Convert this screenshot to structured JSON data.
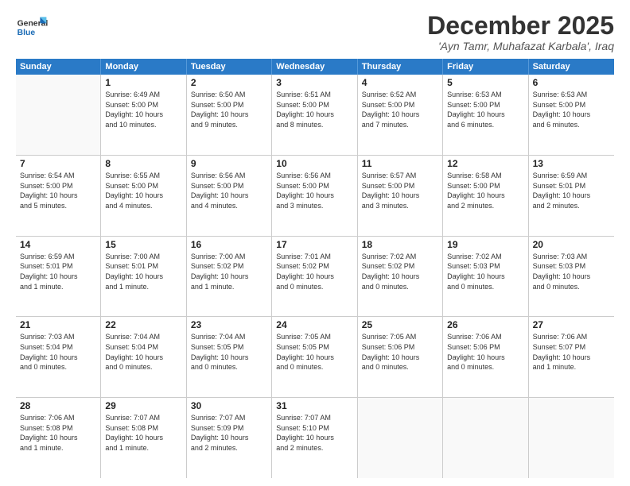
{
  "header": {
    "logo_general": "General",
    "logo_blue": "Blue",
    "title": "December 2025",
    "subtitle": "'Ayn Tamr, Muhafazat Karbala', Iraq"
  },
  "calendar": {
    "days_of_week": [
      "Sunday",
      "Monday",
      "Tuesday",
      "Wednesday",
      "Thursday",
      "Friday",
      "Saturday"
    ],
    "weeks": [
      [
        {
          "day": "",
          "text": ""
        },
        {
          "day": "1",
          "text": "Sunrise: 6:49 AM\nSunset: 5:00 PM\nDaylight: 10 hours\nand 10 minutes."
        },
        {
          "day": "2",
          "text": "Sunrise: 6:50 AM\nSunset: 5:00 PM\nDaylight: 10 hours\nand 9 minutes."
        },
        {
          "day": "3",
          "text": "Sunrise: 6:51 AM\nSunset: 5:00 PM\nDaylight: 10 hours\nand 8 minutes."
        },
        {
          "day": "4",
          "text": "Sunrise: 6:52 AM\nSunset: 5:00 PM\nDaylight: 10 hours\nand 7 minutes."
        },
        {
          "day": "5",
          "text": "Sunrise: 6:53 AM\nSunset: 5:00 PM\nDaylight: 10 hours\nand 6 minutes."
        },
        {
          "day": "6",
          "text": "Sunrise: 6:53 AM\nSunset: 5:00 PM\nDaylight: 10 hours\nand 6 minutes."
        }
      ],
      [
        {
          "day": "7",
          "text": "Sunrise: 6:54 AM\nSunset: 5:00 PM\nDaylight: 10 hours\nand 5 minutes."
        },
        {
          "day": "8",
          "text": "Sunrise: 6:55 AM\nSunset: 5:00 PM\nDaylight: 10 hours\nand 4 minutes."
        },
        {
          "day": "9",
          "text": "Sunrise: 6:56 AM\nSunset: 5:00 PM\nDaylight: 10 hours\nand 4 minutes."
        },
        {
          "day": "10",
          "text": "Sunrise: 6:56 AM\nSunset: 5:00 PM\nDaylight: 10 hours\nand 3 minutes."
        },
        {
          "day": "11",
          "text": "Sunrise: 6:57 AM\nSunset: 5:00 PM\nDaylight: 10 hours\nand 3 minutes."
        },
        {
          "day": "12",
          "text": "Sunrise: 6:58 AM\nSunset: 5:00 PM\nDaylight: 10 hours\nand 2 minutes."
        },
        {
          "day": "13",
          "text": "Sunrise: 6:59 AM\nSunset: 5:01 PM\nDaylight: 10 hours\nand 2 minutes."
        }
      ],
      [
        {
          "day": "14",
          "text": "Sunrise: 6:59 AM\nSunset: 5:01 PM\nDaylight: 10 hours\nand 1 minute."
        },
        {
          "day": "15",
          "text": "Sunrise: 7:00 AM\nSunset: 5:01 PM\nDaylight: 10 hours\nand 1 minute."
        },
        {
          "day": "16",
          "text": "Sunrise: 7:00 AM\nSunset: 5:02 PM\nDaylight: 10 hours\nand 1 minute."
        },
        {
          "day": "17",
          "text": "Sunrise: 7:01 AM\nSunset: 5:02 PM\nDaylight: 10 hours\nand 0 minutes."
        },
        {
          "day": "18",
          "text": "Sunrise: 7:02 AM\nSunset: 5:02 PM\nDaylight: 10 hours\nand 0 minutes."
        },
        {
          "day": "19",
          "text": "Sunrise: 7:02 AM\nSunset: 5:03 PM\nDaylight: 10 hours\nand 0 minutes."
        },
        {
          "day": "20",
          "text": "Sunrise: 7:03 AM\nSunset: 5:03 PM\nDaylight: 10 hours\nand 0 minutes."
        }
      ],
      [
        {
          "day": "21",
          "text": "Sunrise: 7:03 AM\nSunset: 5:04 PM\nDaylight: 10 hours\nand 0 minutes."
        },
        {
          "day": "22",
          "text": "Sunrise: 7:04 AM\nSunset: 5:04 PM\nDaylight: 10 hours\nand 0 minutes."
        },
        {
          "day": "23",
          "text": "Sunrise: 7:04 AM\nSunset: 5:05 PM\nDaylight: 10 hours\nand 0 minutes."
        },
        {
          "day": "24",
          "text": "Sunrise: 7:05 AM\nSunset: 5:05 PM\nDaylight: 10 hours\nand 0 minutes."
        },
        {
          "day": "25",
          "text": "Sunrise: 7:05 AM\nSunset: 5:06 PM\nDaylight: 10 hours\nand 0 minutes."
        },
        {
          "day": "26",
          "text": "Sunrise: 7:06 AM\nSunset: 5:06 PM\nDaylight: 10 hours\nand 0 minutes."
        },
        {
          "day": "27",
          "text": "Sunrise: 7:06 AM\nSunset: 5:07 PM\nDaylight: 10 hours\nand 1 minute."
        }
      ],
      [
        {
          "day": "28",
          "text": "Sunrise: 7:06 AM\nSunset: 5:08 PM\nDaylight: 10 hours\nand 1 minute."
        },
        {
          "day": "29",
          "text": "Sunrise: 7:07 AM\nSunset: 5:08 PM\nDaylight: 10 hours\nand 1 minute."
        },
        {
          "day": "30",
          "text": "Sunrise: 7:07 AM\nSunset: 5:09 PM\nDaylight: 10 hours\nand 2 minutes."
        },
        {
          "day": "31",
          "text": "Sunrise: 7:07 AM\nSunset: 5:10 PM\nDaylight: 10 hours\nand 2 minutes."
        },
        {
          "day": "",
          "text": ""
        },
        {
          "day": "",
          "text": ""
        },
        {
          "day": "",
          "text": ""
        }
      ]
    ]
  }
}
